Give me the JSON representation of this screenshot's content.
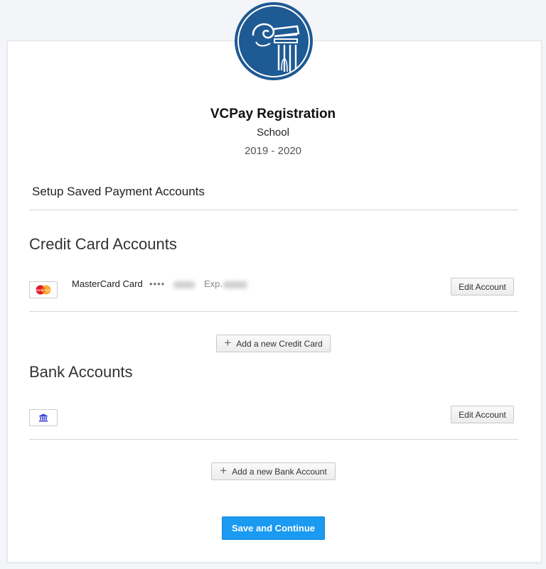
{
  "header": {
    "logo_icon": "ionic-column-icon",
    "logo_color": "#1e5a93",
    "title": "VCPay Registration",
    "subtitle": "School",
    "years": "2019 - 2020"
  },
  "setup": {
    "heading": "Setup Saved Payment Accounts"
  },
  "credit_cards": {
    "heading": "Credit Card Accounts",
    "items": [
      {
        "icon": "mastercard-icon",
        "name": "MasterCard Card",
        "mask": "••••",
        "exp_label": "Exp.",
        "edit_label": "Edit Account"
      }
    ],
    "add_label": "Add a new Credit Card"
  },
  "bank_accounts": {
    "heading": "Bank Accounts",
    "items": [
      {
        "icon": "bank-icon",
        "edit_label": "Edit Account"
      }
    ],
    "add_label": "Add a new Bank Account"
  },
  "footer": {
    "save_label": "Save and Continue",
    "accent_color": "#1a9af0"
  }
}
